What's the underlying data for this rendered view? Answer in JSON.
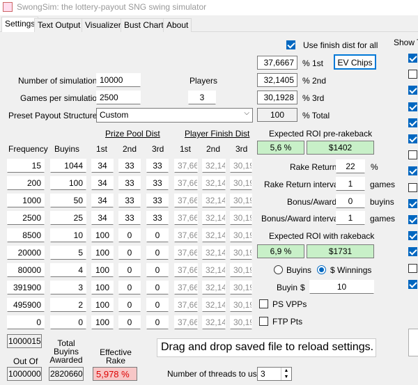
{
  "window": {
    "title": "SwongSim: the lottery-payout SNG swing simulator"
  },
  "tabs": [
    "Settings",
    "Text Output",
    "Visualizer",
    "Bust Chart",
    "About"
  ],
  "settings": {
    "use_finish_dist_label": "Use finish dist for all",
    "show_label": "Show T",
    "finish_pct": [
      "37,6667",
      "32,1405",
      "30,1928"
    ],
    "finish_pct_labels": [
      "% 1st",
      "% 2nd",
      "% 3rd"
    ],
    "total_value": "100",
    "total_label": "% Total",
    "ev_chips_label": "EV Chips",
    "num_sims_label": "Number of simulations",
    "num_sims_value": "10000",
    "games_per_sim_label": "Games per simulation",
    "games_per_sim_value": "2500",
    "players_label": "Players",
    "players_value": "3",
    "preset_label": "Preset Payout Structures",
    "preset_value": "Custom",
    "prize_pool_dist_label": "Prize Pool Dist",
    "player_finish_dist_label": "Player Finish Dist",
    "col_headers": {
      "frequency": "Frequency",
      "buyins": "Buyins",
      "p1": "1st",
      "p2": "2nd",
      "p3": "3rd",
      "f1": "1st",
      "f2": "2nd",
      "f3": "3rd"
    },
    "rows": [
      {
        "freq": "15",
        "buyins": "1044",
        "p1": "34",
        "p2": "33",
        "p3": "33",
        "f1": "37,66",
        "f2": "32,14",
        "f3": "30,19"
      },
      {
        "freq": "200",
        "buyins": "100",
        "p1": "34",
        "p2": "33",
        "p3": "33",
        "f1": "37,66",
        "f2": "32,14",
        "f3": "30,19"
      },
      {
        "freq": "1000",
        "buyins": "50",
        "p1": "34",
        "p2": "33",
        "p3": "33",
        "f1": "37,66",
        "f2": "32,14",
        "f3": "30,19"
      },
      {
        "freq": "2500",
        "buyins": "25",
        "p1": "34",
        "p2": "33",
        "p3": "33",
        "f1": "37,66",
        "f2": "32,14",
        "f3": "30,19"
      },
      {
        "freq": "8500",
        "buyins": "10",
        "p1": "100",
        "p2": "0",
        "p3": "0",
        "f1": "37,66",
        "f2": "32,14",
        "f3": "30,19"
      },
      {
        "freq": "20000",
        "buyins": "5",
        "p1": "100",
        "p2": "0",
        "p3": "0",
        "f1": "37,66",
        "f2": "32,14",
        "f3": "30,19"
      },
      {
        "freq": "80000",
        "buyins": "4",
        "p1": "100",
        "p2": "0",
        "p3": "0",
        "f1": "37,66",
        "f2": "32,14",
        "f3": "30,19"
      },
      {
        "freq": "391900",
        "buyins": "3",
        "p1": "100",
        "p2": "0",
        "p3": "0",
        "f1": "37,66",
        "f2": "32,14",
        "f3": "30,19"
      },
      {
        "freq": "495900",
        "buyins": "2",
        "p1": "100",
        "p2": "0",
        "p3": "0",
        "f1": "37,66",
        "f2": "32,14",
        "f3": "30,19"
      },
      {
        "freq": "0",
        "buyins": "0",
        "p1": "100",
        "p2": "0",
        "p3": "0",
        "f1": "37,66",
        "f2": "32,14",
        "f3": "30,19"
      }
    ],
    "freq_total": "1000015",
    "out_of_label": "Out Of",
    "out_of_value": "1000000",
    "total_buyins_label": "Total Buyins Awarded",
    "total_buyins_value": "2820660",
    "eff_rake_label": "Effective Rake",
    "eff_rake_value": "5,978 %",
    "roi_pre_label": "Expected ROI pre-rakeback",
    "roi_pre_pct": "5,6 %",
    "roi_pre_usd": "$1402",
    "rake_return_label": "Rake Return",
    "rake_return_value": "22",
    "rake_return_unit": "%",
    "rake_interval_label": "Rake Return interval",
    "rake_interval_value": "1",
    "rake_interval_unit": "games",
    "bonus_label": "Bonus/Award",
    "bonus_value": "0",
    "bonus_unit": "buyins",
    "bonus_interval_label": "Bonus/Award interval",
    "bonus_interval_value": "1",
    "bonus_interval_unit": "games",
    "roi_rb_label": "Expected ROI with rakeback",
    "roi_rb_pct": "6,9 %",
    "roi_rb_usd": "$1731",
    "radio_buyins_label": "Buyins",
    "radio_winnings_label": "$ Winnings",
    "buyin_label": "Buyin",
    "buyin_currency": "$",
    "buyin_value": "10",
    "ps_vpps_label": "PS VPPs",
    "ftp_pts_label": "FTP Pts",
    "drag_drop_label": "Drag and drop saved file to reload settings.",
    "threads_label": "Number of threads to use",
    "threads_value": "3",
    "show_checkboxes": [
      true,
      false,
      true,
      true,
      true,
      true,
      false,
      true,
      false,
      true,
      true,
      true,
      true,
      false,
      true
    ]
  }
}
